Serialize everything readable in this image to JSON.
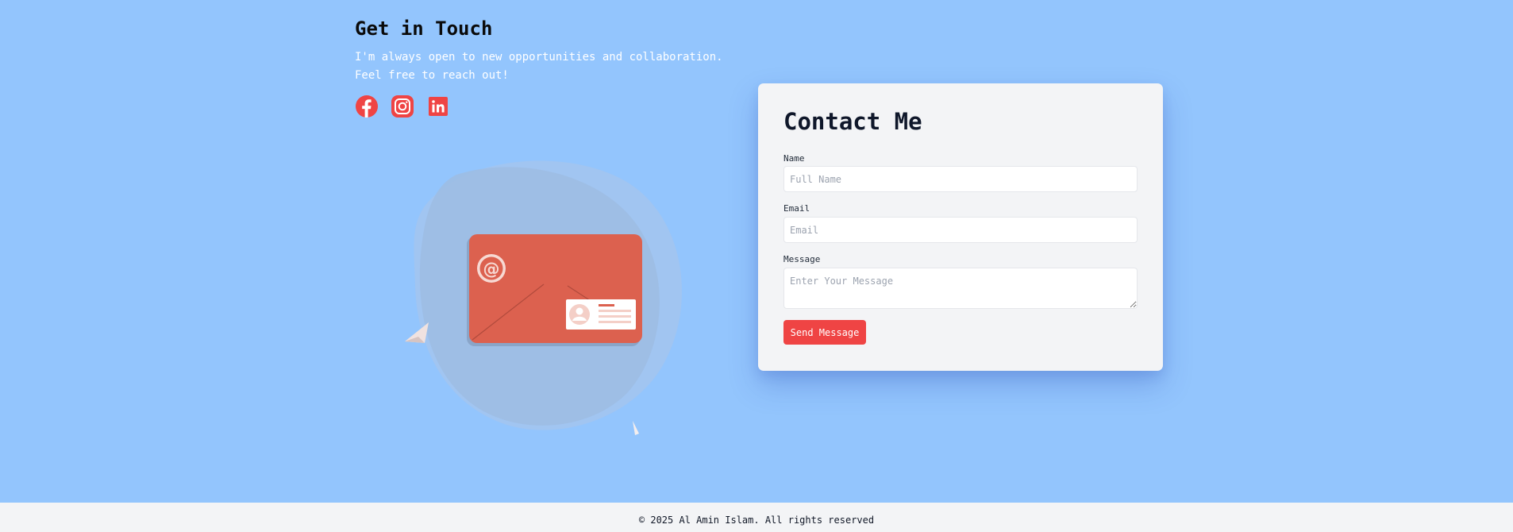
{
  "intro": {
    "title": "Get in Touch",
    "text": "I'm always open to new opportunities and collaboration. Feel free to reach out!"
  },
  "socials": [
    {
      "icon": "facebook-icon"
    },
    {
      "icon": "instagram-icon"
    },
    {
      "icon": "linkedin-icon"
    }
  ],
  "illustration": {
    "icon": "envelope-at-illustration"
  },
  "contact": {
    "title": "Contact Me",
    "name_label": "Name",
    "name_placeholder": "Full Name",
    "email_label": "Email",
    "email_placeholder": "Email",
    "message_label": "Message",
    "message_placeholder": "Enter Your Message",
    "send_label": "Send Message"
  },
  "footer": {
    "text": "© 2025 Al Amin Islam. All rights reserved"
  },
  "colors": {
    "background": "#93c5fd",
    "accent": "#ef4444",
    "card": "#f3f4f6",
    "envelope": "#dc614f"
  }
}
